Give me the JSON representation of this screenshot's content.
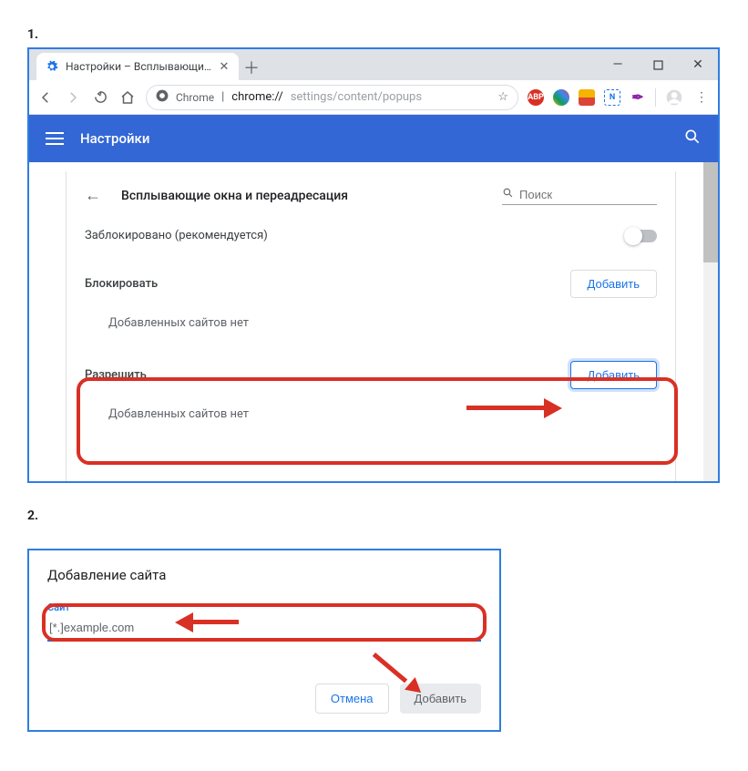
{
  "steps": {
    "one": "1.",
    "two": "2."
  },
  "window": {
    "tab_title": "Настройки – Всплывающие окн",
    "controls": {
      "minimize": "—",
      "close": "✕"
    }
  },
  "omnibox": {
    "secure_label": "Chrome",
    "host_sep": " | ",
    "url_host": "chrome://",
    "url_path": "settings/content/popups"
  },
  "extensions": {
    "abp": "ABP",
    "n": "N"
  },
  "header": {
    "title": "Настройки"
  },
  "page": {
    "title": "Всплывающие окна и переадресация",
    "search_placeholder": "Поиск",
    "blocked_label": "Заблокировано (рекомендуется)",
    "block_section": "Блокировать",
    "allow_section": "Разрешить",
    "add_button": "Добавить",
    "empty_text": "Добавленных сайтов нет"
  },
  "dialog": {
    "title": "Добавление сайта",
    "field_label": "Сайт",
    "input_value": "[*.]example.com",
    "cancel": "Отмена",
    "add": "Добавить"
  }
}
